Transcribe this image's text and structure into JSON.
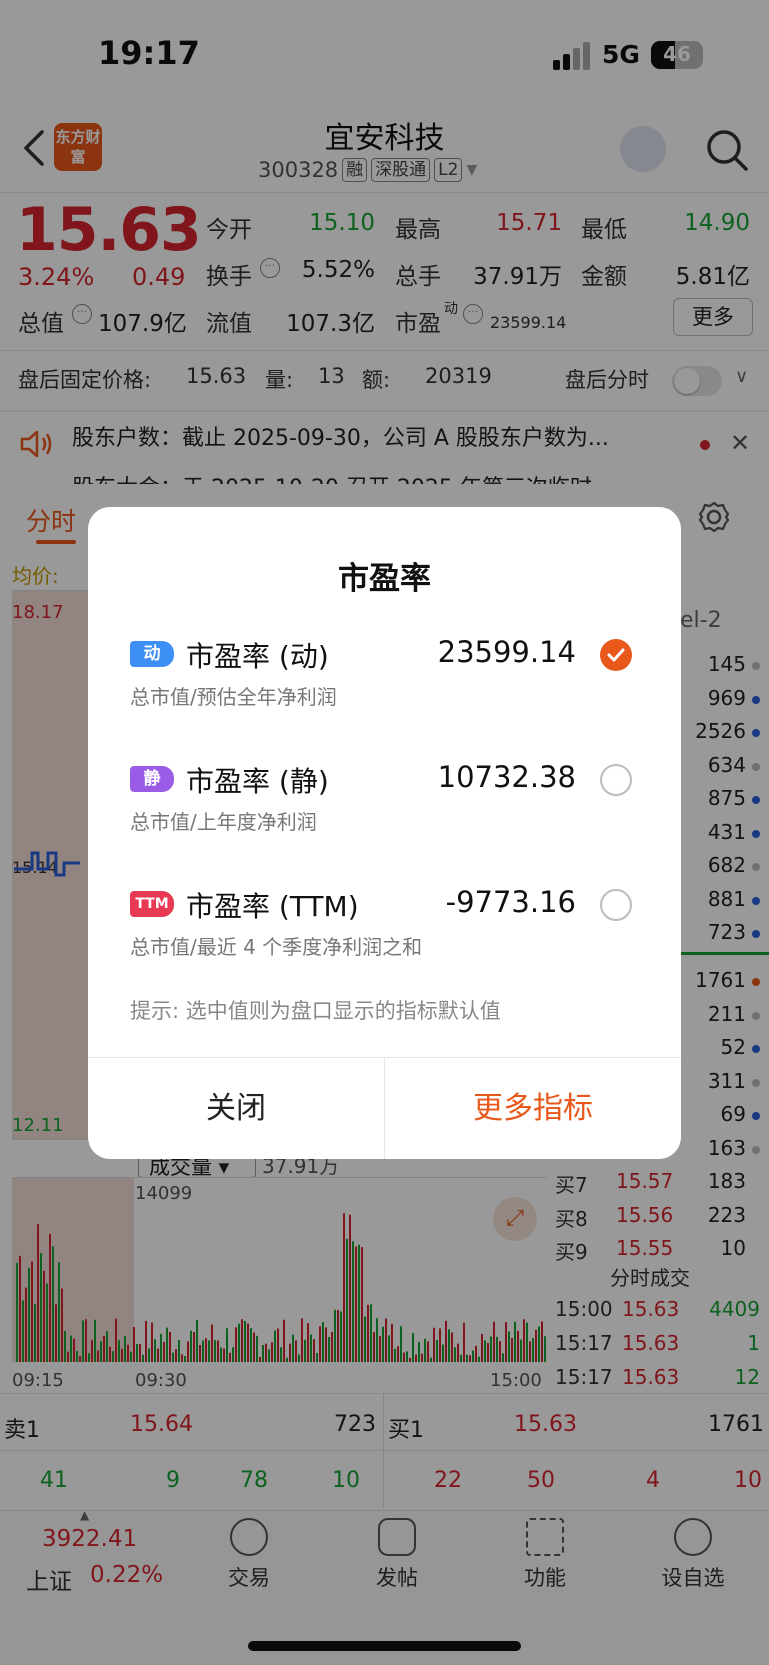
{
  "status_bar": {
    "time": "19:17",
    "network": "5G",
    "battery": "46"
  },
  "header": {
    "logo_text": "东方财富",
    "stock_name": "宜安科技",
    "stock_code": "300328",
    "tags": [
      "融",
      "深股通",
      "L2"
    ]
  },
  "quote": {
    "price": "15.63",
    "change_pct": "3.24%",
    "change": "0.49",
    "fields": [
      {
        "label": "今开",
        "value": "15.10",
        "color": "green"
      },
      {
        "label": "最高",
        "value": "15.71",
        "color": "red"
      },
      {
        "label": "最低",
        "value": "14.90",
        "color": "green"
      },
      {
        "label": "换手",
        "value": "5.52%",
        "color": "black"
      },
      {
        "label": "总手",
        "value": "37.91万",
        "color": "black"
      },
      {
        "label": "金额",
        "value": "5.81亿",
        "color": "black"
      },
      {
        "label": "总值",
        "value": "107.9亿",
        "color": "black"
      },
      {
        "label": "流值",
        "value": "107.3亿",
        "color": "black"
      },
      {
        "label": "市盈",
        "value": "23599.14",
        "color": "black"
      }
    ],
    "pe_superscript": "动",
    "more_label": "更多"
  },
  "after_hours": {
    "label": "盘后固定价格:",
    "price": "15.63",
    "vol_label": "量:",
    "vol": "13",
    "amt_label": "额:",
    "amt": "20319",
    "toggle_label": "盘后分时"
  },
  "news": {
    "line1": "股东户数：截止 2025-09-30，公司 A 股股东户数为...",
    "line2": "股东大会：于 2025-10-20 召开 2025 年第三次临时"
  },
  "tabs": {
    "first": "分时"
  },
  "chart": {
    "avg_label": "均价:",
    "top_price": "18.17",
    "bottom_price": "12.11",
    "mid_price": "15.14",
    "vol_label": "成交量",
    "vol_total": "37.91万",
    "vol_max": "14099",
    "time_start": "09:15",
    "time_mid": "09:30",
    "time_end": "15:00"
  },
  "order_book": {
    "level_label": "el-2",
    "sell_vols": [
      "145",
      "969",
      "2526",
      "634",
      "875",
      "431",
      "682",
      "881",
      "723"
    ],
    "buy_vols": [
      "1761",
      "211",
      "52",
      "311",
      "69",
      "163"
    ],
    "buy_levels": [
      {
        "label": "买7",
        "price": "15.57",
        "vol": "183"
      },
      {
        "label": "买8",
        "price": "15.56",
        "vol": "223"
      },
      {
        "label": "买9",
        "price": "15.55",
        "vol": "10"
      }
    ],
    "ticks_label": "分时成交",
    "ticks": [
      {
        "time": "15:00",
        "price": "15.63",
        "vol": "4409"
      },
      {
        "time": "15:17",
        "price": "15.63",
        "vol": "1"
      },
      {
        "time": "15:17",
        "price": "15.63",
        "vol": "12"
      }
    ]
  },
  "bottom_quote": {
    "sell1_label": "卖1",
    "sell1_price": "15.64",
    "sell1_vol": "723",
    "buy1_label": "买1",
    "buy1_price": "15.63",
    "buy1_vol": "1761",
    "nums_left": [
      "41",
      "9",
      "78",
      "10"
    ],
    "nums_right": [
      "22",
      "50",
      "4",
      "10"
    ]
  },
  "nav": {
    "index_value": "3922.41",
    "index_name": "上证",
    "index_pct": "0.22%",
    "items": [
      "交易",
      "发帖",
      "功能",
      "设自选"
    ]
  },
  "dialog": {
    "title": "市盈率",
    "options": [
      {
        "badge": "动",
        "name": "市盈率 (动)",
        "value": "23599.14",
        "desc": "总市值/预估全年净利润",
        "selected": true,
        "badge_color": "#3d8ef5"
      },
      {
        "badge": "静",
        "name": "市盈率 (静)",
        "value": "10732.38",
        "desc": "总市值/上年度净利润",
        "selected": false,
        "badge_color": "#9a5ce6"
      },
      {
        "badge": "TTM",
        "name": "市盈率 (TTM)",
        "value": "-9773.16",
        "desc": "总市值/最近 4 个季度净利润之和",
        "selected": false,
        "badge_color": "#e93a55"
      }
    ],
    "hint": "提示: 选中值则为盘口显示的指标默认值",
    "close_label": "关闭",
    "more_label": "更多指标",
    "accent": "#e9581b"
  }
}
